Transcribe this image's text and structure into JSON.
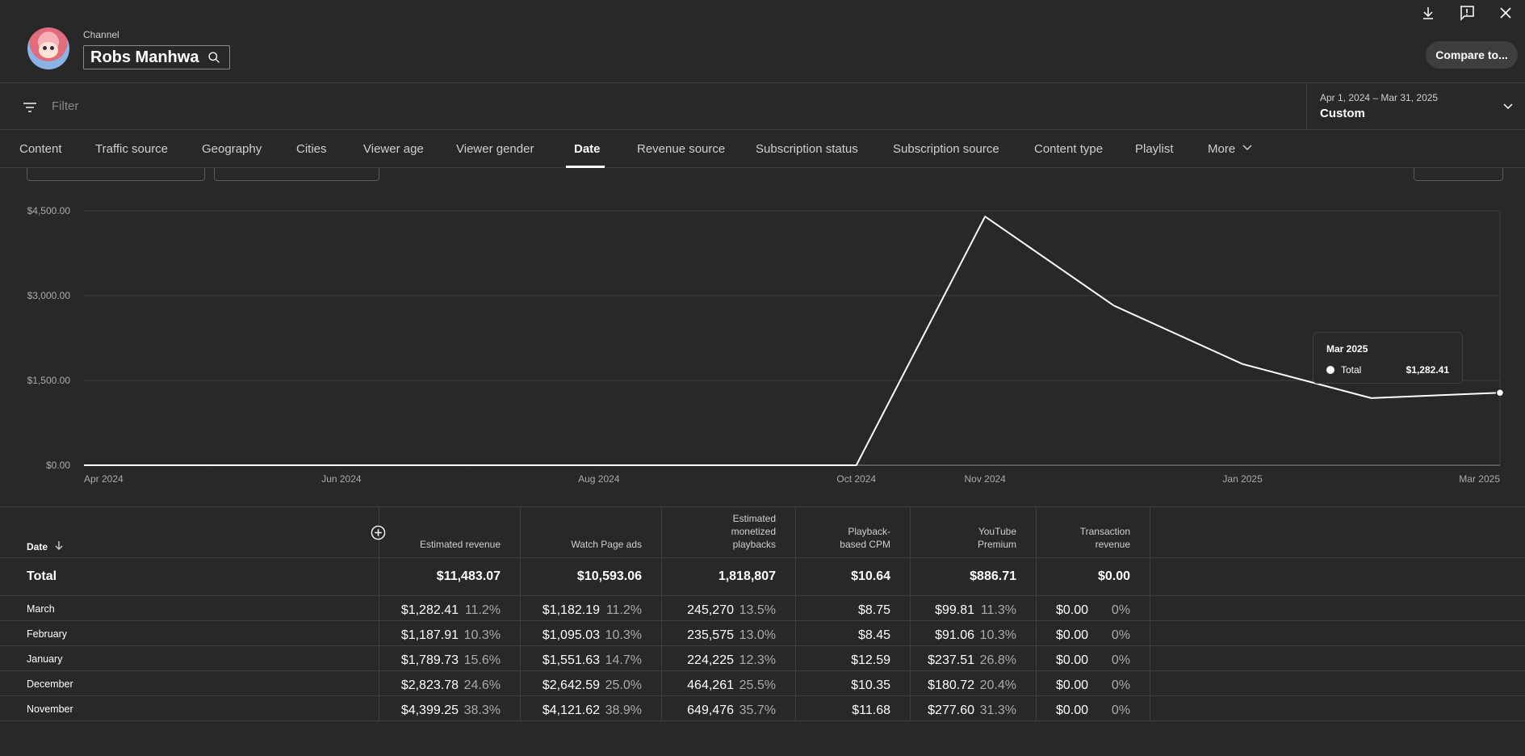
{
  "header": {
    "channel_label": "Channel",
    "channel_name": "Robs Manhwa",
    "compare_label": "Compare to..."
  },
  "filter": {
    "placeholder": "Filter"
  },
  "date_range": {
    "range": "Apr 1, 2024 – Mar 31, 2025",
    "preset": "Custom"
  },
  "tabs": [
    {
      "label": "Content"
    },
    {
      "label": "Traffic source"
    },
    {
      "label": "Geography"
    },
    {
      "label": "Cities"
    },
    {
      "label": "Viewer age"
    },
    {
      "label": "Viewer gender"
    },
    {
      "label": "Date"
    },
    {
      "label": "Revenue source"
    },
    {
      "label": "Subscription status"
    },
    {
      "label": "Subscription source"
    },
    {
      "label": "Content type"
    },
    {
      "label": "Playlist"
    },
    {
      "label": "More"
    }
  ],
  "active_tab": "Date",
  "chart_data": {
    "type": "line",
    "x": [
      "Apr 2024",
      "May 2024",
      "Jun 2024",
      "Jul 2024",
      "Aug 2024",
      "Sep 2024",
      "Oct 2024",
      "Nov 2024",
      "Dec 2024",
      "Jan 2025",
      "Feb 2025",
      "Mar 2025"
    ],
    "series": [
      {
        "name": "Total",
        "values": [
          0,
          0,
          0,
          0,
          0,
          0,
          0,
          4399.25,
          2823.78,
          1789.73,
          1187.91,
          1282.41
        ]
      }
    ],
    "x_tick_labels": [
      "Apr 2024",
      "Jun 2024",
      "Aug 2024",
      "Oct 2024",
      "Nov 2024",
      "Jan 2025",
      "Mar 2025"
    ],
    "y_tick_labels": [
      "$0.00",
      "$1,500.00",
      "$3,000.00",
      "$4,500.00"
    ],
    "ylim": [
      0,
      4500
    ],
    "grid": true,
    "line_color": "#ffffff"
  },
  "tooltip": {
    "date": "Mar 2025",
    "series": "Total",
    "value": "$1,282.41"
  },
  "table": {
    "date_header": "Date",
    "columns": [
      {
        "lines": [
          "Estimated revenue"
        ]
      },
      {
        "lines": [
          "Watch Page ads"
        ]
      },
      {
        "lines": [
          "Estimated",
          "monetized",
          "playbacks"
        ]
      },
      {
        "lines": [
          "Playback-",
          "based CPM"
        ]
      },
      {
        "lines": [
          "YouTube",
          "Premium"
        ]
      },
      {
        "lines": [
          "Transaction",
          "revenue"
        ]
      }
    ],
    "total": {
      "label": "Total",
      "values": [
        "$11,483.07",
        "$10,593.06",
        "1,818,807",
        "$10.64",
        "$886.71",
        "$0.00"
      ]
    },
    "rows": [
      {
        "label": "March",
        "cells": [
          [
            "$1,282.41",
            "11.2%"
          ],
          [
            "$1,182.19",
            "11.2%"
          ],
          [
            "245,270",
            "13.5%"
          ],
          [
            "$8.75",
            ""
          ],
          [
            "$99.81",
            "11.3%"
          ],
          [
            "$0.00",
            "0%"
          ]
        ]
      },
      {
        "label": "February",
        "cells": [
          [
            "$1,187.91",
            "10.3%"
          ],
          [
            "$1,095.03",
            "10.3%"
          ],
          [
            "235,575",
            "13.0%"
          ],
          [
            "$8.45",
            ""
          ],
          [
            "$91.06",
            "10.3%"
          ],
          [
            "$0.00",
            "0%"
          ]
        ]
      },
      {
        "label": "January",
        "cells": [
          [
            "$1,789.73",
            "15.6%"
          ],
          [
            "$1,551.63",
            "14.7%"
          ],
          [
            "224,225",
            "12.3%"
          ],
          [
            "$12.59",
            ""
          ],
          [
            "$237.51",
            "26.8%"
          ],
          [
            "$0.00",
            "0%"
          ]
        ]
      },
      {
        "label": "December",
        "cells": [
          [
            "$2,823.78",
            "24.6%"
          ],
          [
            "$2,642.59",
            "25.0%"
          ],
          [
            "464,261",
            "25.5%"
          ],
          [
            "$10.35",
            ""
          ],
          [
            "$180.72",
            "20.4%"
          ],
          [
            "$0.00",
            "0%"
          ]
        ]
      },
      {
        "label": "November",
        "cells": [
          [
            "$4,399.25",
            "38.3%"
          ],
          [
            "$4,121.62",
            "38.9%"
          ],
          [
            "649,476",
            "35.7%"
          ],
          [
            "$11.68",
            ""
          ],
          [
            "$277.60",
            "31.3%"
          ],
          [
            "$0.00",
            "0%"
          ]
        ]
      }
    ]
  }
}
